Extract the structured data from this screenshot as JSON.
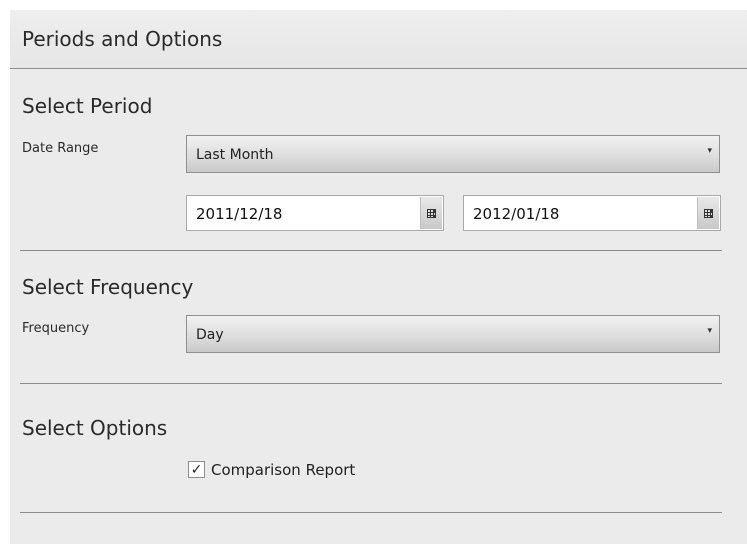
{
  "panel": {
    "title": "Periods and Options"
  },
  "period": {
    "heading": "Select Period",
    "date_range_label": "Date Range",
    "date_range_value": "Last Month",
    "start_date": "2011/12/18",
    "end_date": "2012/01/18"
  },
  "frequency": {
    "heading": "Select Frequency",
    "label": "Frequency",
    "value": "Day"
  },
  "options": {
    "heading": "Select Options",
    "comparison_label": "Comparison Report",
    "comparison_checked": true,
    "check_glyph": "✓"
  },
  "icons": {
    "dropdown": "chevron-down-icon",
    "calendar": "calendar-icon",
    "check": "checkmark-icon"
  }
}
